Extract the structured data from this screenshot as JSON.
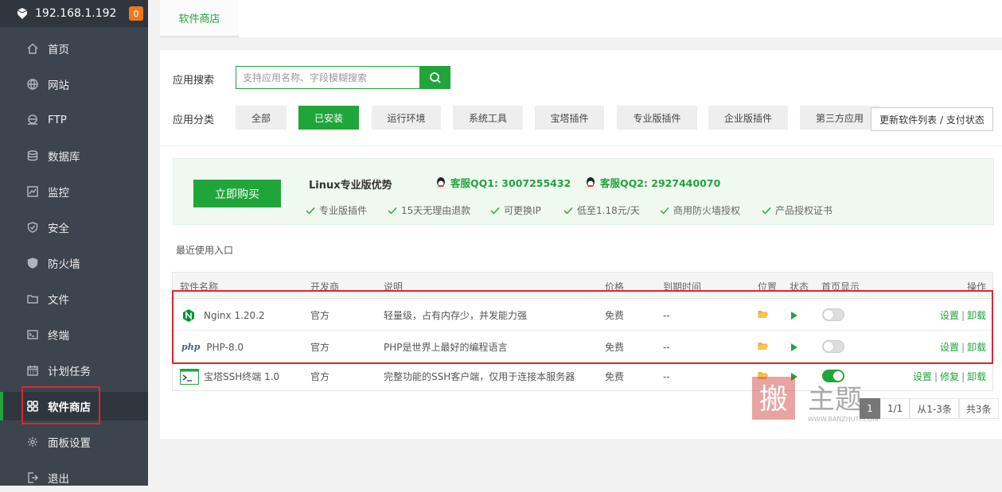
{
  "sidebar": {
    "host": "192.168.1.192",
    "badge": "0",
    "items": [
      {
        "label": "首页",
        "icon": "home-icon"
      },
      {
        "label": "网站",
        "icon": "globe-icon"
      },
      {
        "label": "FTP",
        "icon": "ftp-icon"
      },
      {
        "label": "数据库",
        "icon": "database-icon"
      },
      {
        "label": "监控",
        "icon": "monitor-icon"
      },
      {
        "label": "安全",
        "icon": "shield-icon"
      },
      {
        "label": "防火墙",
        "icon": "firewall-icon"
      },
      {
        "label": "文件",
        "icon": "folder-icon"
      },
      {
        "label": "终端",
        "icon": "terminal-icon"
      },
      {
        "label": "计划任务",
        "icon": "calendar-icon"
      },
      {
        "label": "软件商店",
        "icon": "grid-icon",
        "active": true
      },
      {
        "label": "面板设置",
        "icon": "gear-icon"
      },
      {
        "label": "退出",
        "icon": "logout-icon"
      }
    ]
  },
  "tabs": {
    "store": "软件商店"
  },
  "search": {
    "label": "应用搜索",
    "placeholder": "支持应用名称、字段模糊搜索"
  },
  "category": {
    "label": "应用分类",
    "items": [
      "全部",
      "已安装",
      "运行环境",
      "系统工具",
      "宝塔插件",
      "专业版插件",
      "企业版插件",
      "第三方应用"
    ],
    "selected": "已安装"
  },
  "refresh_label": "更新软件列表 / 支付状态",
  "promo": {
    "buy": "立即购买",
    "title": "Linux专业版优势",
    "qq1": "客服QQ1: 3007255432",
    "qq2": "客服QQ2: 2927440070",
    "features": [
      "专业版插件",
      "15天无理由退款",
      "可更换IP",
      "低至1.18元/天",
      "商用防火墙授权",
      "产品授权证书"
    ]
  },
  "recent": "最近使用入口",
  "table": {
    "headers": [
      "软件名称",
      "开发商",
      "说明",
      "价格",
      "到期时间",
      "位置",
      "状态",
      "首页显示",
      "操作"
    ],
    "rows": [
      {
        "name": "Nginx 1.20.2",
        "vendor": "官方",
        "desc": "轻量级，占有内存少，并发能力强",
        "price": "免费",
        "expire": "--",
        "show_home": false,
        "ops": [
          "设置",
          "卸载"
        ],
        "icon": "nginx-icon"
      },
      {
        "name": "PHP-8.0",
        "vendor": "官方",
        "desc": "PHP是世界上最好的编程语言",
        "price": "免费",
        "expire": "--",
        "show_home": false,
        "ops": [
          "设置",
          "卸载"
        ],
        "icon": "php-icon"
      },
      {
        "name": "宝塔SSH终端 1.0",
        "vendor": "官方",
        "desc": "完整功能的SSH客户端，仅用于连接本服务器",
        "price": "免费",
        "expire": "--",
        "show_home": true,
        "ops": [
          "设置",
          "修复",
          "卸载"
        ],
        "icon": "terminal-app-icon"
      }
    ]
  },
  "pager": {
    "current": "1",
    "pages": "1/1",
    "range": "从1-3条",
    "total": "共3条"
  },
  "watermark": {
    "text": "搬主题",
    "url": "WWW.BANZHUTI.COM"
  },
  "colors": {
    "accent": "#20a53a",
    "sidebar": "#3c444d",
    "highlight": "#e0262f"
  }
}
